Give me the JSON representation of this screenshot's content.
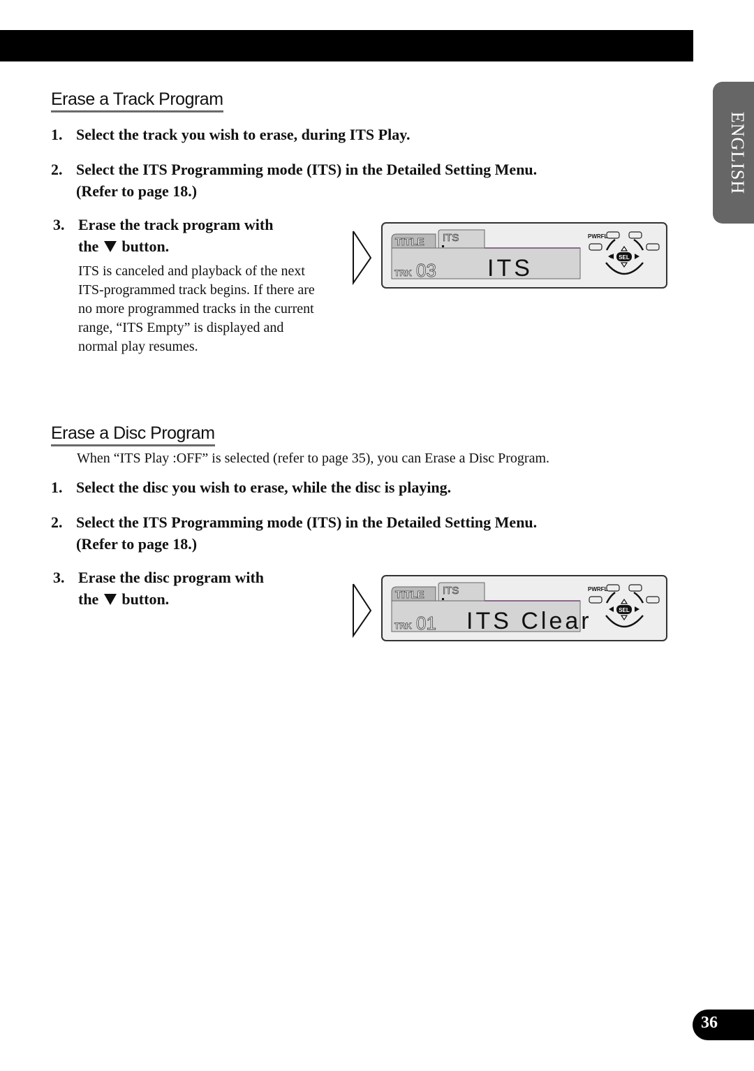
{
  "side_tab": "ENGLISH",
  "page_number": "36",
  "sections": [
    {
      "heading": "Erase a Track Program",
      "steps": [
        {
          "num": "1.",
          "line1": "Select the track you wish to erase, during ITS Play."
        },
        {
          "num": "2.",
          "line1": "Select the ITS Programming mode (ITS) in the Detailed Setting Menu.",
          "line2": "(Refer to page 18.)"
        },
        {
          "num": "3.",
          "line1": "Erase the track program with",
          "line2_pre": "the",
          "line2_post": "button."
        }
      ],
      "note": "ITS is canceled and playback of the next ITS-programmed track begins. If there are no more programmed tracks in the current range, “ITS Empty” is displayed and normal play resumes.",
      "display": {
        "tab1": "TITLE",
        "tab2": "ITS",
        "trk_label": "TRK",
        "trk_num": "03",
        "main_text": "ITS",
        "pwrfl": "PWRFL",
        "sel": "SEL"
      }
    },
    {
      "heading": "Erase a Disc Program",
      "intro": "When “ITS Play :OFF” is selected (refer to page 35), you can Erase a Disc Program.",
      "steps": [
        {
          "num": "1.",
          "line1": "Select the disc you wish to erase, while the disc is playing."
        },
        {
          "num": "2.",
          "line1": "Select the ITS Programming mode (ITS) in the Detailed Setting Menu.",
          "line2": "(Refer to page 18.)"
        },
        {
          "num": "3.",
          "line1": "Erase the disc program with",
          "line2_pre": "the",
          "line2_post": "button."
        }
      ],
      "display": {
        "tab1": "TITLE",
        "tab2": "ITS",
        "trk_label": "TRK",
        "trk_num": "01",
        "main_text": "ITS Clear",
        "pwrfl": "PWRFL",
        "sel": "SEL"
      }
    }
  ]
}
